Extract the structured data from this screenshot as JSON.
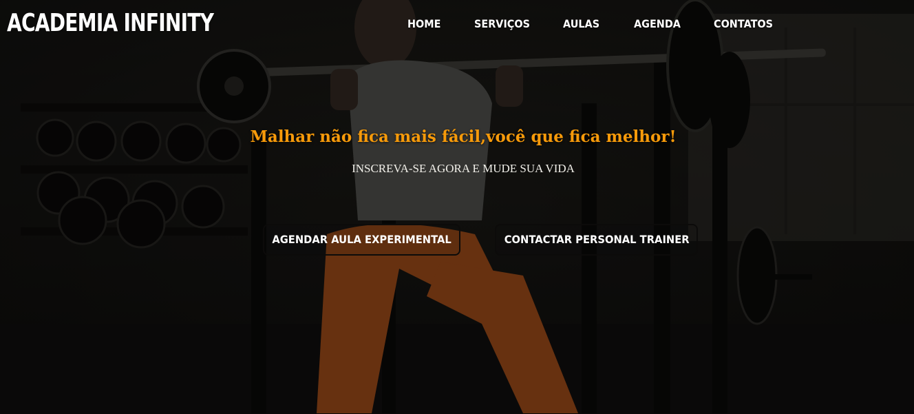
{
  "brand": {
    "name": "ACADEMIA INFINITY"
  },
  "nav": {
    "items": [
      {
        "label": "HOME"
      },
      {
        "label": "SERVIÇOS"
      },
      {
        "label": "AULAS"
      },
      {
        "label": "AGENDA"
      },
      {
        "label": "CONTATOS"
      }
    ]
  },
  "hero": {
    "headline": "Malhar não fica mais fácil,você que fica melhor!",
    "subheadline": "INSCREVA-SE AGORA E MUDE SUA VIDA",
    "buttons": [
      {
        "label": "AGENDAR AULA EXPERIMENTAL"
      },
      {
        "label": "CONTACTAR PERSONAL TRAINER"
      }
    ]
  },
  "colors": {
    "headline": "#f79a0a",
    "text": "#ffffff",
    "button_border": "#0c0b0a",
    "background": "#1b1a17",
    "leggings": "#c35a1c"
  }
}
